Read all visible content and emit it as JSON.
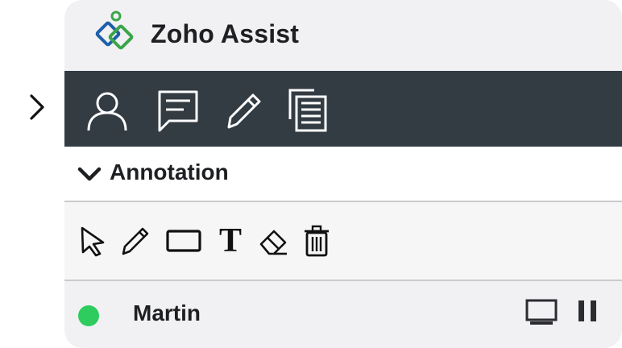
{
  "app": {
    "name": "Zoho Assist"
  },
  "colors": {
    "toolbar_bg": "#333b43",
    "panel_bg": "#f1f1f3",
    "online_status": "#2ecc5e",
    "logo_green": "#3aa54a",
    "logo_blue": "#1f5fa8"
  },
  "toolbar": {
    "icons": [
      "user-icon",
      "chat-icon",
      "pencil-icon",
      "copy-icon"
    ]
  },
  "annotation": {
    "title": "Annotation",
    "text_tool_glyph": "T",
    "tools": [
      "pointer-icon",
      "pencil-icon",
      "rectangle-icon",
      "text-icon",
      "eraser-icon",
      "trash-icon"
    ]
  },
  "session": {
    "user_name": "Martin",
    "status": "online",
    "actions": [
      "monitor-icon",
      "pause-icon"
    ]
  }
}
